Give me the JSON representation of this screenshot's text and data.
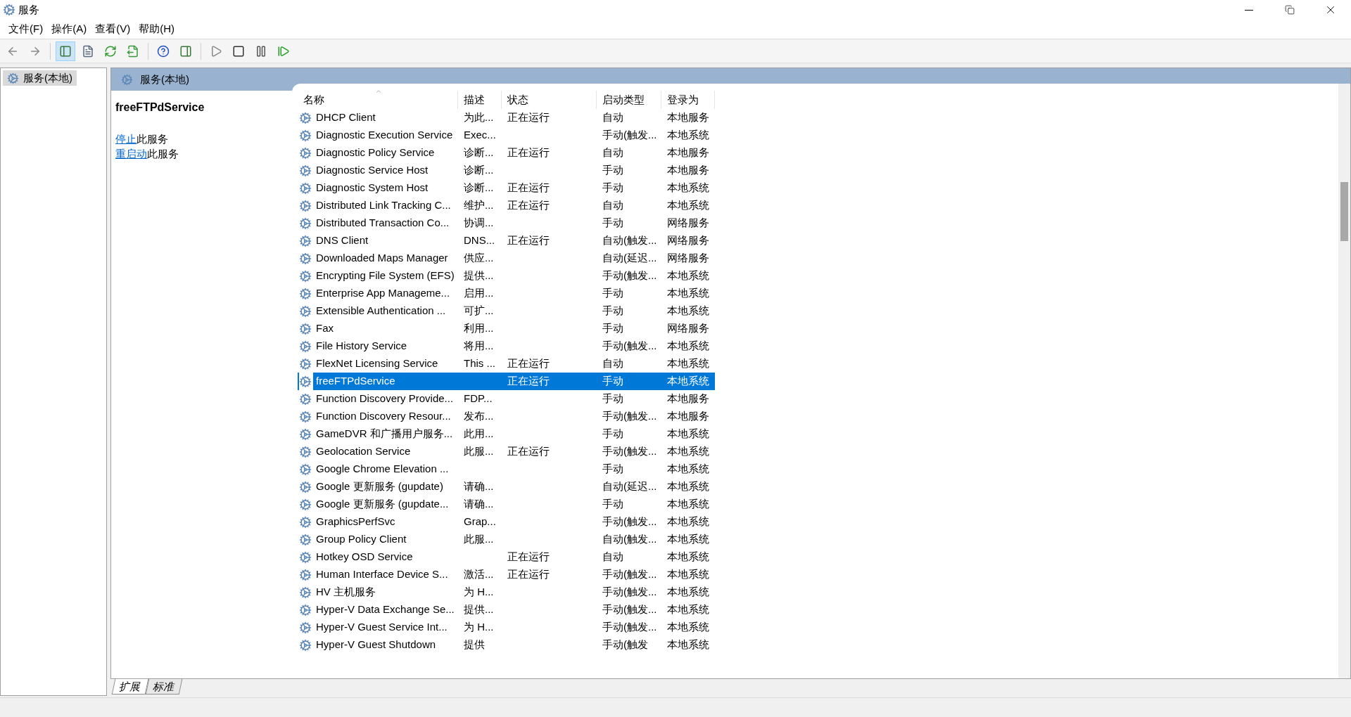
{
  "window": {
    "title": "服务"
  },
  "menu": [
    "文件(F)",
    "操作(A)",
    "查看(V)",
    "帮助(H)"
  ],
  "toolbar": [
    {
      "kind": "back",
      "selected": false
    },
    {
      "kind": "forward",
      "selected": false
    },
    {
      "kind": "sep"
    },
    {
      "kind": "tree",
      "selected": true
    },
    {
      "kind": "properties",
      "selected": false
    },
    {
      "kind": "refresh",
      "selected": false
    },
    {
      "kind": "export",
      "selected": false
    },
    {
      "kind": "sep"
    },
    {
      "kind": "help",
      "selected": false
    },
    {
      "kind": "actionpane",
      "selected": false
    },
    {
      "kind": "sep"
    },
    {
      "kind": "play",
      "selected": false
    },
    {
      "kind": "stop",
      "selected": false
    },
    {
      "kind": "pause",
      "selected": false
    },
    {
      "kind": "resume",
      "selected": false
    }
  ],
  "tree": [
    {
      "label": "服务(本地)",
      "selected": true
    }
  ],
  "panel": {
    "title": "服务(本地)",
    "details": {
      "name": "freeFTPdService",
      "actions": [
        {
          "link": "停止",
          "text": "此服务"
        },
        {
          "link": "重启动",
          "text": "此服务"
        }
      ]
    },
    "table": {
      "columns": [
        "名称",
        "描述",
        "状态",
        "启动类型",
        "登录为"
      ],
      "rows": [
        {
          "name": "DHCP Client",
          "description": "为此...",
          "status": "正在运行",
          "startup": "自动",
          "logon": "本地服务",
          "selected": false
        },
        {
          "name": "Diagnostic Execution Service",
          "description": "Exec...",
          "status": "",
          "startup": "手动(触发...",
          "logon": "本地系统",
          "selected": false
        },
        {
          "name": "Diagnostic Policy Service",
          "description": "诊断...",
          "status": "正在运行",
          "startup": "自动",
          "logon": "本地服务",
          "selected": false
        },
        {
          "name": "Diagnostic Service Host",
          "description": "诊断...",
          "status": "",
          "startup": "手动",
          "logon": "本地服务",
          "selected": false
        },
        {
          "name": "Diagnostic System Host",
          "description": "诊断...",
          "status": "正在运行",
          "startup": "手动",
          "logon": "本地系统",
          "selected": false
        },
        {
          "name": "Distributed Link Tracking C...",
          "description": "维护...",
          "status": "正在运行",
          "startup": "自动",
          "logon": "本地系统",
          "selected": false
        },
        {
          "name": "Distributed Transaction Co...",
          "description": "协调...",
          "status": "",
          "startup": "手动",
          "logon": "网络服务",
          "selected": false
        },
        {
          "name": "DNS Client",
          "description": "DNS...",
          "status": "正在运行",
          "startup": "自动(触发...",
          "logon": "网络服务",
          "selected": false
        },
        {
          "name": "Downloaded Maps Manager",
          "description": "供应...",
          "status": "",
          "startup": "自动(延迟...",
          "logon": "网络服务",
          "selected": false
        },
        {
          "name": "Encrypting File System (EFS)",
          "description": "提供...",
          "status": "",
          "startup": "手动(触发...",
          "logon": "本地系统",
          "selected": false
        },
        {
          "name": "Enterprise App Manageme...",
          "description": "启用...",
          "status": "",
          "startup": "手动",
          "logon": "本地系统",
          "selected": false
        },
        {
          "name": "Extensible Authentication ...",
          "description": "可扩...",
          "status": "",
          "startup": "手动",
          "logon": "本地系统",
          "selected": false
        },
        {
          "name": "Fax",
          "description": "利用...",
          "status": "",
          "startup": "手动",
          "logon": "网络服务",
          "selected": false
        },
        {
          "name": "File History Service",
          "description": "将用...",
          "status": "",
          "startup": "手动(触发...",
          "logon": "本地系统",
          "selected": false
        },
        {
          "name": "FlexNet Licensing Service",
          "description": "This ...",
          "status": "正在运行",
          "startup": "自动",
          "logon": "本地系统",
          "selected": false
        },
        {
          "name": "freeFTPdService",
          "description": "",
          "status": "正在运行",
          "startup": "手动",
          "logon": "本地系统",
          "selected": true
        },
        {
          "name": "Function Discovery Provide...",
          "description": "FDP...",
          "status": "",
          "startup": "手动",
          "logon": "本地服务",
          "selected": false
        },
        {
          "name": "Function Discovery Resour...",
          "description": "发布...",
          "status": "",
          "startup": "手动(触发...",
          "logon": "本地服务",
          "selected": false
        },
        {
          "name": "GameDVR 和广播用户服务...",
          "description": "此用...",
          "status": "",
          "startup": "手动",
          "logon": "本地系统",
          "selected": false
        },
        {
          "name": "Geolocation Service",
          "description": "此服...",
          "status": "正在运行",
          "startup": "手动(触发...",
          "logon": "本地系统",
          "selected": false
        },
        {
          "name": "Google Chrome Elevation ...",
          "description": "",
          "status": "",
          "startup": "手动",
          "logon": "本地系统",
          "selected": false
        },
        {
          "name": "Google 更新服务 (gupdate)",
          "description": "请确...",
          "status": "",
          "startup": "自动(延迟...",
          "logon": "本地系统",
          "selected": false
        },
        {
          "name": "Google 更新服务 (gupdate...",
          "description": "请确...",
          "status": "",
          "startup": "手动",
          "logon": "本地系统",
          "selected": false
        },
        {
          "name": "GraphicsPerfSvc",
          "description": "Grap...",
          "status": "",
          "startup": "手动(触发...",
          "logon": "本地系统",
          "selected": false
        },
        {
          "name": "Group Policy Client",
          "description": "此服...",
          "status": "",
          "startup": "自动(触发...",
          "logon": "本地系统",
          "selected": false
        },
        {
          "name": "Hotkey OSD Service",
          "description": "",
          "status": "正在运行",
          "startup": "自动",
          "logon": "本地系统",
          "selected": false
        },
        {
          "name": "Human Interface Device S...",
          "description": "激活...",
          "status": "正在运行",
          "startup": "手动(触发...",
          "logon": "本地系统",
          "selected": false
        },
        {
          "name": "HV 主机服务",
          "description": "为 H...",
          "status": "",
          "startup": "手动(触发...",
          "logon": "本地系统",
          "selected": false
        },
        {
          "name": "Hyper-V Data Exchange Se...",
          "description": "提供...",
          "status": "",
          "startup": "手动(触发...",
          "logon": "本地系统",
          "selected": false
        },
        {
          "name": "Hyper-V Guest Service Int...",
          "description": "为 H...",
          "status": "",
          "startup": "手动(触发...",
          "logon": "本地系统",
          "selected": false
        },
        {
          "name": "Hyper-V Guest Shutdown",
          "description": "提供",
          "status": "",
          "startup": "手动(触发",
          "logon": "本地系统",
          "selected": false
        }
      ]
    },
    "tabs": [
      {
        "label": "扩展",
        "selected": true
      },
      {
        "label": "标准",
        "selected": false
      }
    ]
  }
}
